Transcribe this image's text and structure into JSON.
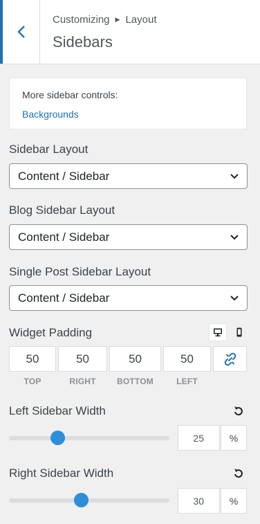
{
  "header": {
    "breadcrumb_root": "Customizing",
    "breadcrumb_parent": "Layout",
    "title": "Sidebars"
  },
  "notice": {
    "title": "More sidebar controls:",
    "link": "Backgrounds"
  },
  "sidebar_layout": {
    "label": "Sidebar Layout",
    "value": "Content / Sidebar"
  },
  "blog_sidebar_layout": {
    "label": "Blog Sidebar Layout",
    "value": "Content / Sidebar"
  },
  "single_post_sidebar_layout": {
    "label": "Single Post Sidebar Layout",
    "value": "Content / Sidebar"
  },
  "widget_padding": {
    "label": "Widget Padding",
    "top": "50",
    "right": "50",
    "bottom": "50",
    "left": "50",
    "top_label": "TOP",
    "right_label": "RIGHT",
    "bottom_label": "BOTTOM",
    "left_label": "LEFT",
    "active_device": "desktop"
  },
  "left_sidebar_width": {
    "label": "Left Sidebar Width",
    "value": "25",
    "unit": "%",
    "slider_fraction": 0.3
  },
  "right_sidebar_width": {
    "label": "Right Sidebar Width",
    "value": "30",
    "unit": "%",
    "slider_fraction": 0.45
  },
  "colors": {
    "accent": "#2271b1",
    "slider_thumb": "#2e8fd8"
  }
}
